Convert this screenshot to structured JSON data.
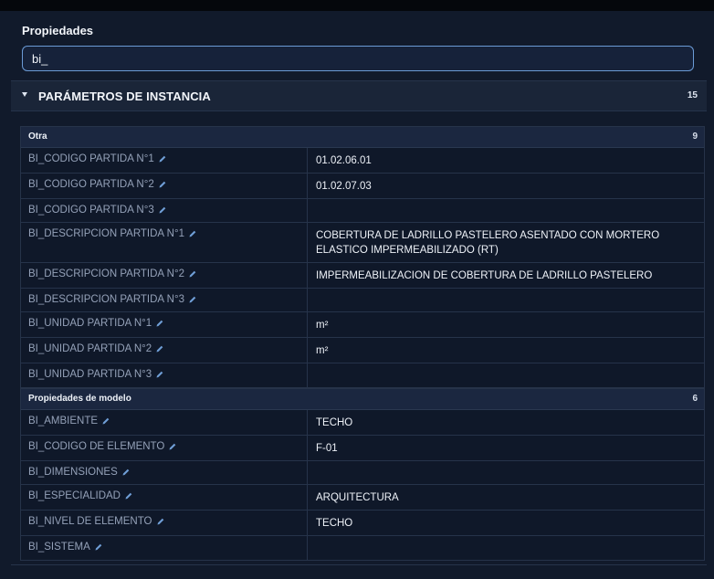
{
  "panel": {
    "title": "Propiedades",
    "search_value": "bi_"
  },
  "section": {
    "title": "PARÁMETROS DE INSTANCIA",
    "count": "15"
  },
  "groups": [
    {
      "title": "Otra",
      "count": "9",
      "rows": [
        {
          "name": "BI_CODIGO PARTIDA N°1",
          "value": "01.02.06.01"
        },
        {
          "name": "BI_CODIGO PARTIDA N°2",
          "value": "01.02.07.03"
        },
        {
          "name": "BI_CODIGO PARTIDA N°3",
          "value": ""
        },
        {
          "name": "BI_DESCRIPCION PARTIDA N°1",
          "value": "COBERTURA DE LADRILLO PASTELERO ASENTADO CON MORTERO ELASTICO IMPERMEABILIZADO (RT)"
        },
        {
          "name": "BI_DESCRIPCION PARTIDA N°2",
          "value": "IMPERMEABILIZACION DE COBERTURA DE LADRILLO PASTELERO"
        },
        {
          "name": "BI_DESCRIPCION PARTIDA N°3",
          "value": ""
        },
        {
          "name": "BI_UNIDAD PARTIDA N°1",
          "value": "m²"
        },
        {
          "name": "BI_UNIDAD PARTIDA N°2",
          "value": "m²"
        },
        {
          "name": "BI_UNIDAD PARTIDA N°3",
          "value": ""
        }
      ]
    },
    {
      "title": "Propiedades de modelo",
      "count": "6",
      "rows": [
        {
          "name": "BI_AMBIENTE",
          "value": "TECHO"
        },
        {
          "name": "BI_CODIGO DE ELEMENTO",
          "value": "F-01"
        },
        {
          "name": "BI_DIMENSIONES",
          "value": ""
        },
        {
          "name": "BI_ESPECIALIDAD",
          "value": "ARQUITECTURA"
        },
        {
          "name": "BI_NIVEL DE ELEMENTO",
          "value": "TECHO"
        },
        {
          "name": "BI_SISTEMA",
          "value": ""
        }
      ]
    }
  ],
  "icons": {
    "edit": "pencil-icon",
    "collapse": "caret-down-icon"
  },
  "colors": {
    "background": "#0f1727",
    "accent": "#6b9bd6",
    "label": "#94a1b8",
    "value": "#eef2f8"
  }
}
